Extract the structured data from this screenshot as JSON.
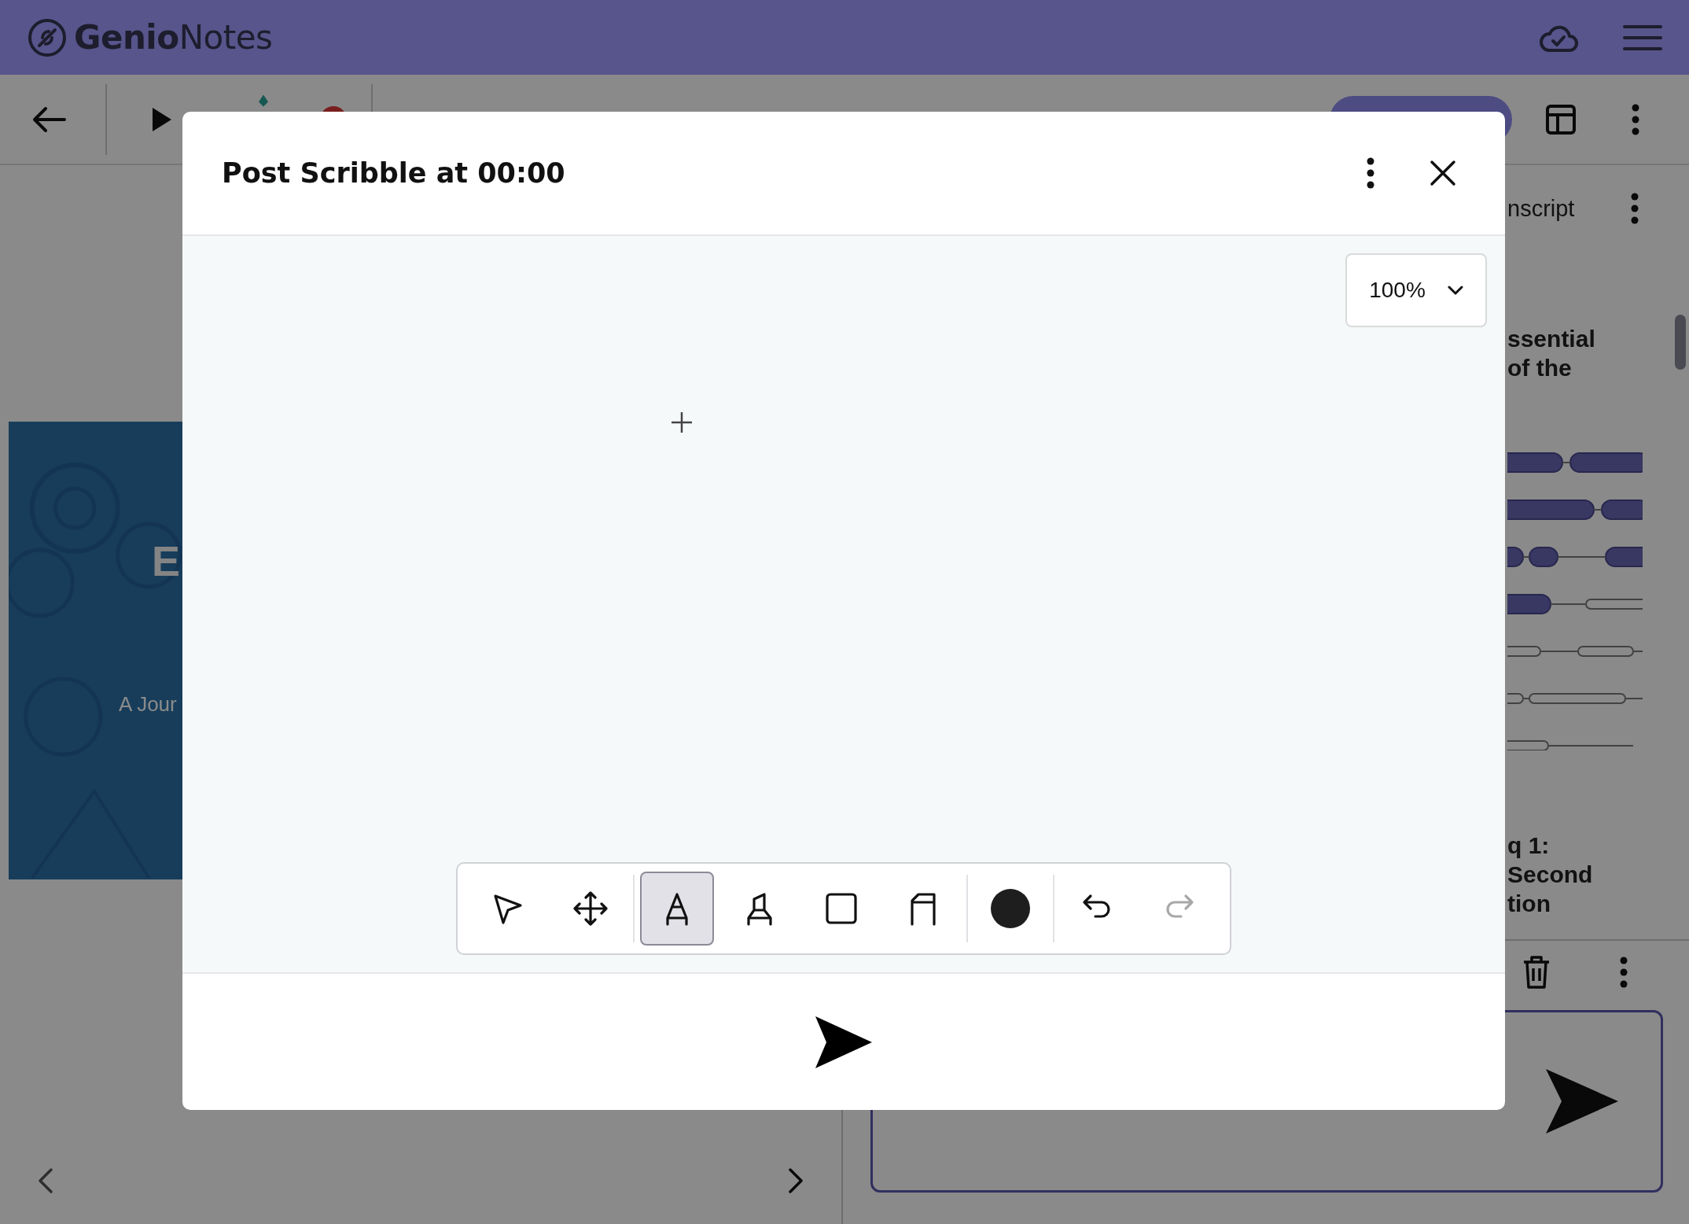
{
  "app_bar": {
    "logo": "**Genio**Notes"
  },
  "slide": {
    "kind": "picture",
    "title_fragment": "E",
    "subtitle_fragment": "A Jour"
  },
  "side_panel": {
    "tab": "nscript",
    "heading_lines": [
      "ssential",
      "of the"
    ],
    "question_lines": [
      "q 1:",
      "Second",
      "tion"
    ]
  },
  "dialog": {
    "title": "Post Scribble at 00:00",
    "zoom": "100%",
    "tools": [
      {
        "kind": "pointer",
        "selected": false
      },
      {
        "kind": "move",
        "selected": false
      },
      {
        "kind": "pen",
        "selected": true
      },
      {
        "kind": "highlighter",
        "selected": false
      },
      {
        "kind": "rectangle",
        "selected": false
      },
      {
        "kind": "arch",
        "selected": false
      }
    ],
    "color_swatch": {
      "color": "#1e1e1e"
    },
    "undo": {
      "disabled": false
    },
    "redo": {
      "disabled": true
    }
  }
}
